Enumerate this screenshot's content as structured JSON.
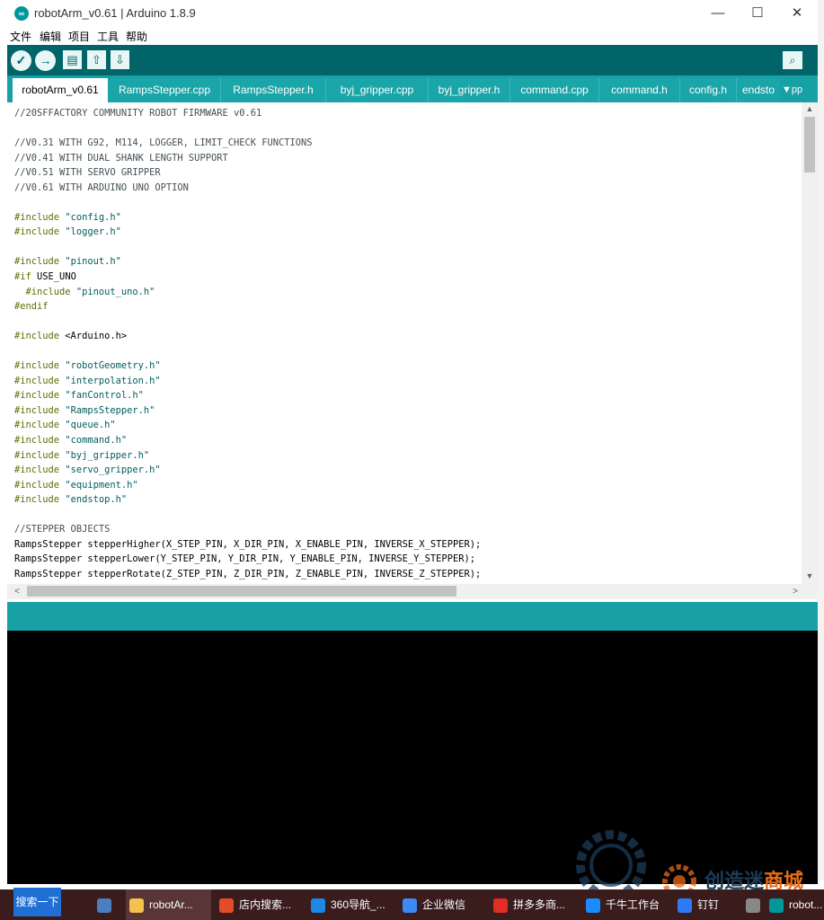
{
  "window": {
    "title": "robotArm_v0.61 | Arduino 1.8.9",
    "minimize_glyph": "—",
    "maximize_glyph": "☐",
    "close_glyph": "✕"
  },
  "menu": [
    "文件",
    "编辑",
    "项目",
    "工具",
    "帮助"
  ],
  "toolbar": {
    "icons": [
      "verify-icon",
      "upload-icon",
      "new-icon",
      "open-icon",
      "save-icon",
      "serial-monitor-icon"
    ],
    "verify_glyph": "✓",
    "upload_glyph": "→",
    "new_glyph": "▤",
    "open_glyph": "⇧",
    "save_glyph": "⇩",
    "serial_glyph": "⌕"
  },
  "tabs": [
    {
      "label": "robotArm_v0.61",
      "active": true
    },
    {
      "label": "RampsStepper.cpp",
      "active": false
    },
    {
      "label": "RampsStepper.h",
      "active": false
    },
    {
      "label": "byj_gripper.cpp",
      "active": false
    },
    {
      "label": "byj_gripper.h",
      "active": false
    },
    {
      "label": "command.cpp",
      "active": false
    },
    {
      "label": "command.h",
      "active": false
    },
    {
      "label": "config.h",
      "active": false
    },
    {
      "label": "endsto",
      "active": false
    }
  ],
  "tab_menu": {
    "glyph": "▼",
    "suffix": "pp"
  },
  "code_lines": [
    "//20SFFACTORY COMMUNITY ROBOT FIRMWARE v0.61",
    "",
    "//V0.31 WITH G92, M114, LOGGER, LIMIT_CHECK FUNCTIONS",
    "//V0.41 WITH DUAL SHANK LENGTH SUPPORT",
    "//V0.51 WITH SERVO GRIPPER",
    "//V0.61 WITH ARDUINO UNO OPTION",
    "",
    "#include \"config.h\"",
    "#include \"logger.h\"",
    "",
    "#include \"pinout.h\"",
    "#if USE_UNO",
    "  #include \"pinout_uno.h\"",
    "#endif",
    "",
    "#include <Arduino.h>",
    "",
    "#include \"robotGeometry.h\"",
    "#include \"interpolation.h\"",
    "#include \"fanControl.h\"",
    "#include \"RampsStepper.h\"",
    "#include \"queue.h\"",
    "#include \"command.h\"",
    "#include \"byj_gripper.h\"",
    "#include \"servo_gripper.h\"",
    "#include \"equipment.h\"",
    "#include \"endstop.h\"",
    "",
    "//STEPPER OBJECTS",
    "RampsStepper stepperHigher(X_STEP_PIN, X_DIR_PIN, X_ENABLE_PIN, INVERSE_X_STEPPER);",
    "RampsStepper stepperLower(Y_STEP_PIN, Y_DIR_PIN, Y_ENABLE_PIN, INVERSE_Y_STEPPER);",
    "RampsStepper stepperRotate(Z_STEP_PIN, Z_DIR_PIN, Z_ENABLE_PIN, INVERSE_Z_STEPPER);"
  ],
  "scroll": {
    "up": "▲",
    "down": "▼",
    "left": "<",
    "right": ">"
  },
  "taskbar": {
    "search_label": "搜索一下",
    "items": [
      {
        "label": "",
        "icon": "calculator-icon",
        "color": "#4a7fc1"
      },
      {
        "label": "robotAr...",
        "icon": "folder-icon",
        "color": "#f2c14e"
      },
      {
        "label": "店内搜索...",
        "icon": "chrome-icon",
        "color": "#e34c26"
      },
      {
        "label": "360导航_...",
        "icon": "edge-icon",
        "color": "#1e88e5"
      },
      {
        "label": "企业微信",
        "icon": "wecom-icon",
        "color": "#3d8af7"
      },
      {
        "label": "拼多多商...",
        "icon": "pinduoduo-icon",
        "color": "#e02e24"
      },
      {
        "label": "千牛工作台",
        "icon": "qianniu-icon",
        "color": "#1a8cff"
      },
      {
        "label": "钉钉",
        "icon": "dingtalk-icon",
        "color": "#2f7bf5"
      },
      {
        "label": "",
        "icon": "app-icon",
        "color": "#888888"
      },
      {
        "label": "robot...",
        "icon": "arduino-icon",
        "color": "#00979c"
      }
    ]
  },
  "watermark": {
    "text_main": "创造迷",
    "text_highlight": "商城"
  }
}
